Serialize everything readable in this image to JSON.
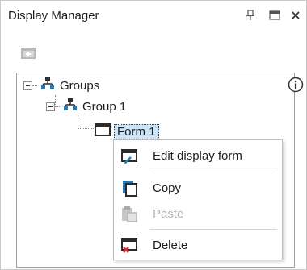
{
  "window": {
    "title": "Display Manager"
  },
  "title_buttons": {
    "pin_icon": "pin-icon",
    "maximize_icon": "maximize-icon",
    "close_icon": "close-icon"
  },
  "toolbar": {
    "new_icon": "new-display-icon"
  },
  "tree": {
    "root": {
      "label": "Groups",
      "expanded": true
    },
    "group": {
      "label": "Group 1",
      "expanded": true
    },
    "form": {
      "label": "Form 1",
      "selected": true
    }
  },
  "context_menu": {
    "items": [
      {
        "label": "Edit display form",
        "enabled": true,
        "icon": "edit-display-icon"
      },
      {
        "label": "Copy",
        "enabled": true,
        "icon": "copy-icon"
      },
      {
        "label": "Paste",
        "enabled": false,
        "icon": "paste-icon"
      },
      {
        "label": "Delete",
        "enabled": true,
        "icon": "delete-display-icon"
      }
    ]
  },
  "colors": {
    "selection": "#cce4f7",
    "accent_blue": "#1e7fb8",
    "delete_red": "#d9262b"
  }
}
